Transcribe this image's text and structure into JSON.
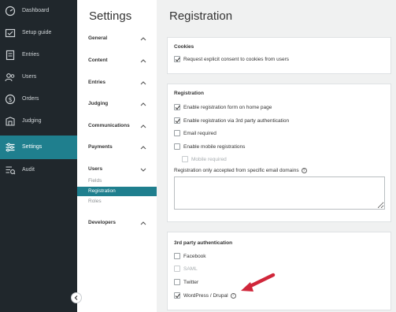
{
  "nav": {
    "items": [
      {
        "label": "Dashboard",
        "icon": "dashboard-icon"
      },
      {
        "label": "Setup guide",
        "icon": "setup-guide-icon"
      },
      {
        "label": "Entries",
        "icon": "entries-icon"
      },
      {
        "label": "Users",
        "icon": "users-icon"
      },
      {
        "label": "Orders",
        "icon": "orders-icon"
      },
      {
        "label": "Judging",
        "icon": "judging-icon"
      },
      {
        "label": "Settings",
        "icon": "settings-icon"
      },
      {
        "label": "Audit",
        "icon": "audit-icon"
      }
    ],
    "active": "Settings"
  },
  "settings": {
    "title": "Settings",
    "sections": [
      {
        "label": "General"
      },
      {
        "label": "Content"
      },
      {
        "label": "Entries"
      },
      {
        "label": "Judging"
      },
      {
        "label": "Communications"
      },
      {
        "label": "Payments"
      },
      {
        "label": "Users",
        "expanded": true,
        "children": [
          "Fields",
          "Registration",
          "Roles"
        ],
        "active_child": "Registration"
      },
      {
        "label": "Developers"
      }
    ]
  },
  "main": {
    "title": "Registration",
    "cookies": {
      "title": "Cookies",
      "options": [
        {
          "label": "Request explicit consent to cookies from users",
          "checked": true
        }
      ]
    },
    "registration": {
      "title": "Registration",
      "options": [
        {
          "label": "Enable registration form on home page",
          "checked": true
        },
        {
          "label": "Enable registration via 3rd party authentication",
          "checked": true
        },
        {
          "label": "Email required",
          "checked": false
        },
        {
          "label": "Enable mobile registrations",
          "checked": false
        },
        {
          "label": "Mobile required",
          "checked": false,
          "disabled": true
        }
      ],
      "domains_label": "Registration only accepted from specific email domains",
      "domains_value": ""
    },
    "third_party": {
      "title": "3rd party authentication",
      "options": [
        {
          "label": "Facebook",
          "checked": false
        },
        {
          "label": "SAML",
          "checked": false,
          "disabled": true
        },
        {
          "label": "Twitter",
          "checked": false
        },
        {
          "label": "WordPress / Drupal",
          "checked": true
        }
      ]
    }
  },
  "colors": {
    "nav_bg": "#20272c",
    "accent": "#1f7f8e",
    "annotation_arrow": "#d0263a"
  }
}
